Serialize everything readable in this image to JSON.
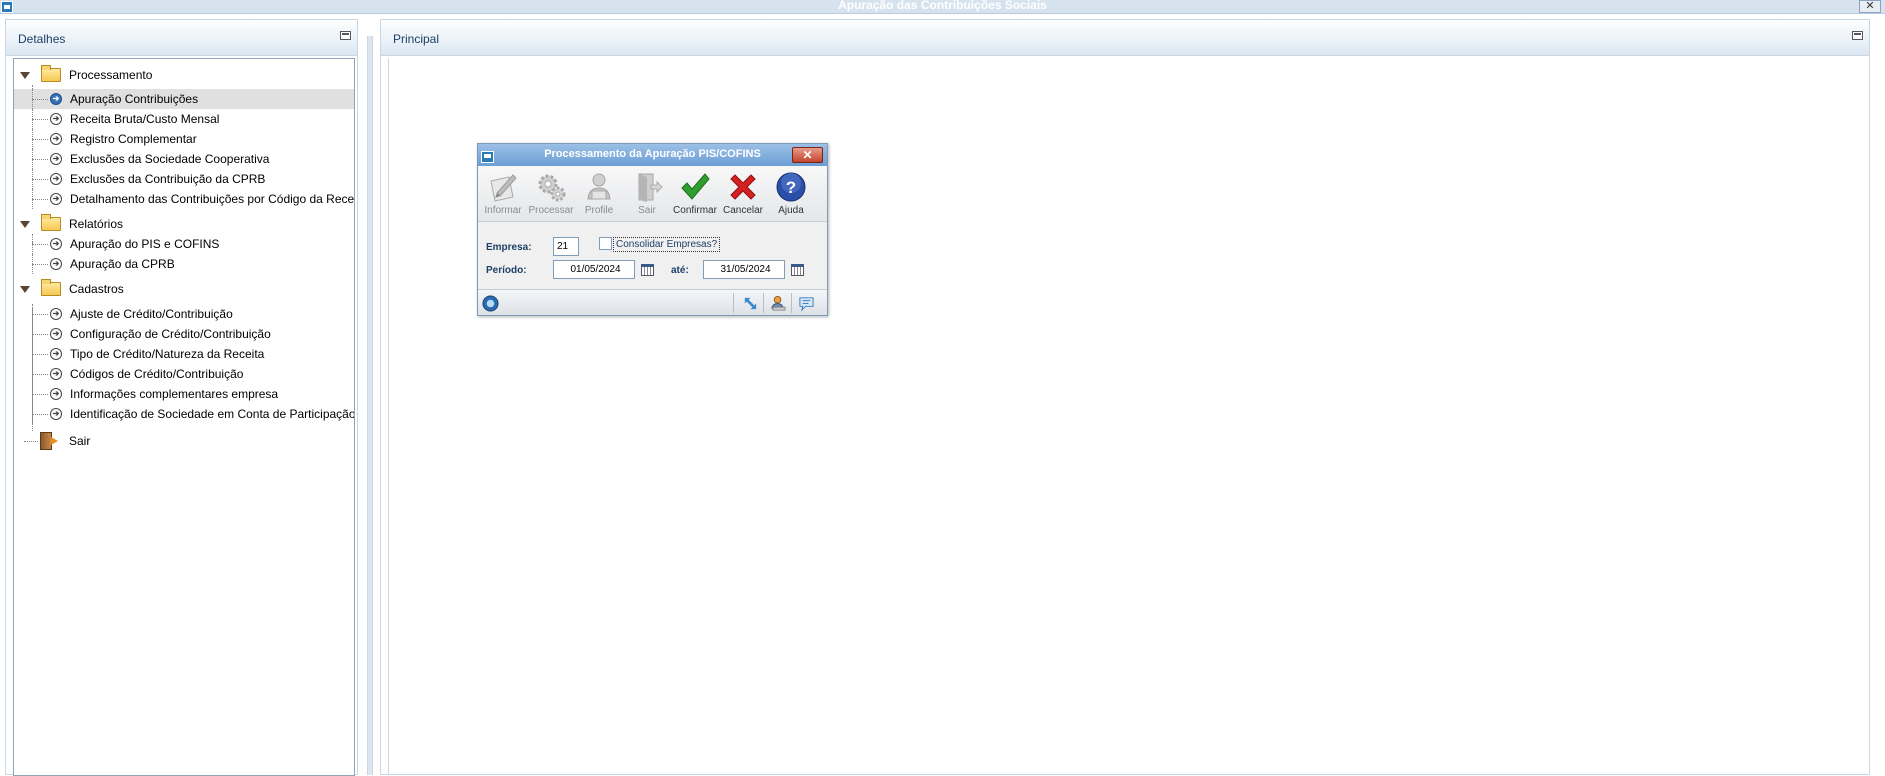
{
  "window": {
    "title": "Apuração das Contribuições Sociais",
    "close_label": "✕"
  },
  "left_panel": {
    "title": "Detalhes",
    "tree": [
      {
        "type": "folder",
        "label": "Processamento"
      },
      {
        "type": "leaf",
        "label": "Apuração Contribuições",
        "selected": true
      },
      {
        "type": "leaf",
        "label": "Receita Bruta/Custo Mensal"
      },
      {
        "type": "leaf",
        "label": "Registro Complementar"
      },
      {
        "type": "leaf",
        "label": "Exclusões da Sociedade Cooperativa"
      },
      {
        "type": "leaf",
        "label": "Exclusões da Contribuição da CPRB"
      },
      {
        "type": "leaf",
        "label": "Detalhamento das Contribuições por Código da Recei"
      },
      {
        "type": "folder",
        "label": "Relatórios"
      },
      {
        "type": "leaf",
        "label": "Apuração do PIS e COFINS"
      },
      {
        "type": "leaf",
        "label": "Apuração da CPRB"
      },
      {
        "type": "folder",
        "label": "Cadastros"
      },
      {
        "type": "leaf",
        "label": "Ajuste de Crédito/Contribuição"
      },
      {
        "type": "leaf",
        "label": "Configuração de Crédito/Contribuição"
      },
      {
        "type": "leaf",
        "label": "Tipo de Crédito/Natureza da Receita"
      },
      {
        "type": "leaf",
        "label": "Códigos de Crédito/Contribuição"
      },
      {
        "type": "leaf",
        "label": "Informações complementares empresa"
      },
      {
        "type": "leaf",
        "label": "Identificação de Sociedade em Conta de Participação"
      },
      {
        "type": "exit",
        "label": "Sair"
      }
    ]
  },
  "right_panel": {
    "title": "Principal"
  },
  "dialog": {
    "title": "Processamento da Apuração PIS/COFINS",
    "close_label": "✕",
    "toolbar": [
      {
        "id": "informar",
        "label": "Informar",
        "disabled": true
      },
      {
        "id": "processar",
        "label": "Processar",
        "disabled": true
      },
      {
        "id": "profile",
        "label": "Profile",
        "disabled": true
      },
      {
        "id": "sair",
        "label": "Sair",
        "disabled": true
      },
      {
        "id": "confirmar",
        "label": "Confirmar",
        "disabled": false
      },
      {
        "id": "cancelar",
        "label": "Cancelar",
        "disabled": false
      },
      {
        "id": "ajuda",
        "label": "Ajuda",
        "disabled": false
      }
    ],
    "form": {
      "empresa_label": "Empresa:",
      "empresa_value": "21",
      "consolidar_label": "Consolidar Empresas?",
      "consolidar_checked": false,
      "periodo_label": "Período:",
      "periodo_value": "01/05/2024",
      "ate_label": "até:",
      "ate_value": "31/05/2024"
    }
  },
  "colors": {
    "accent": "#1e3f66",
    "selection": "#e0e0e0",
    "confirm": "#2e9e2e",
    "cancel": "#d42020",
    "help": "#2b4fa8"
  }
}
